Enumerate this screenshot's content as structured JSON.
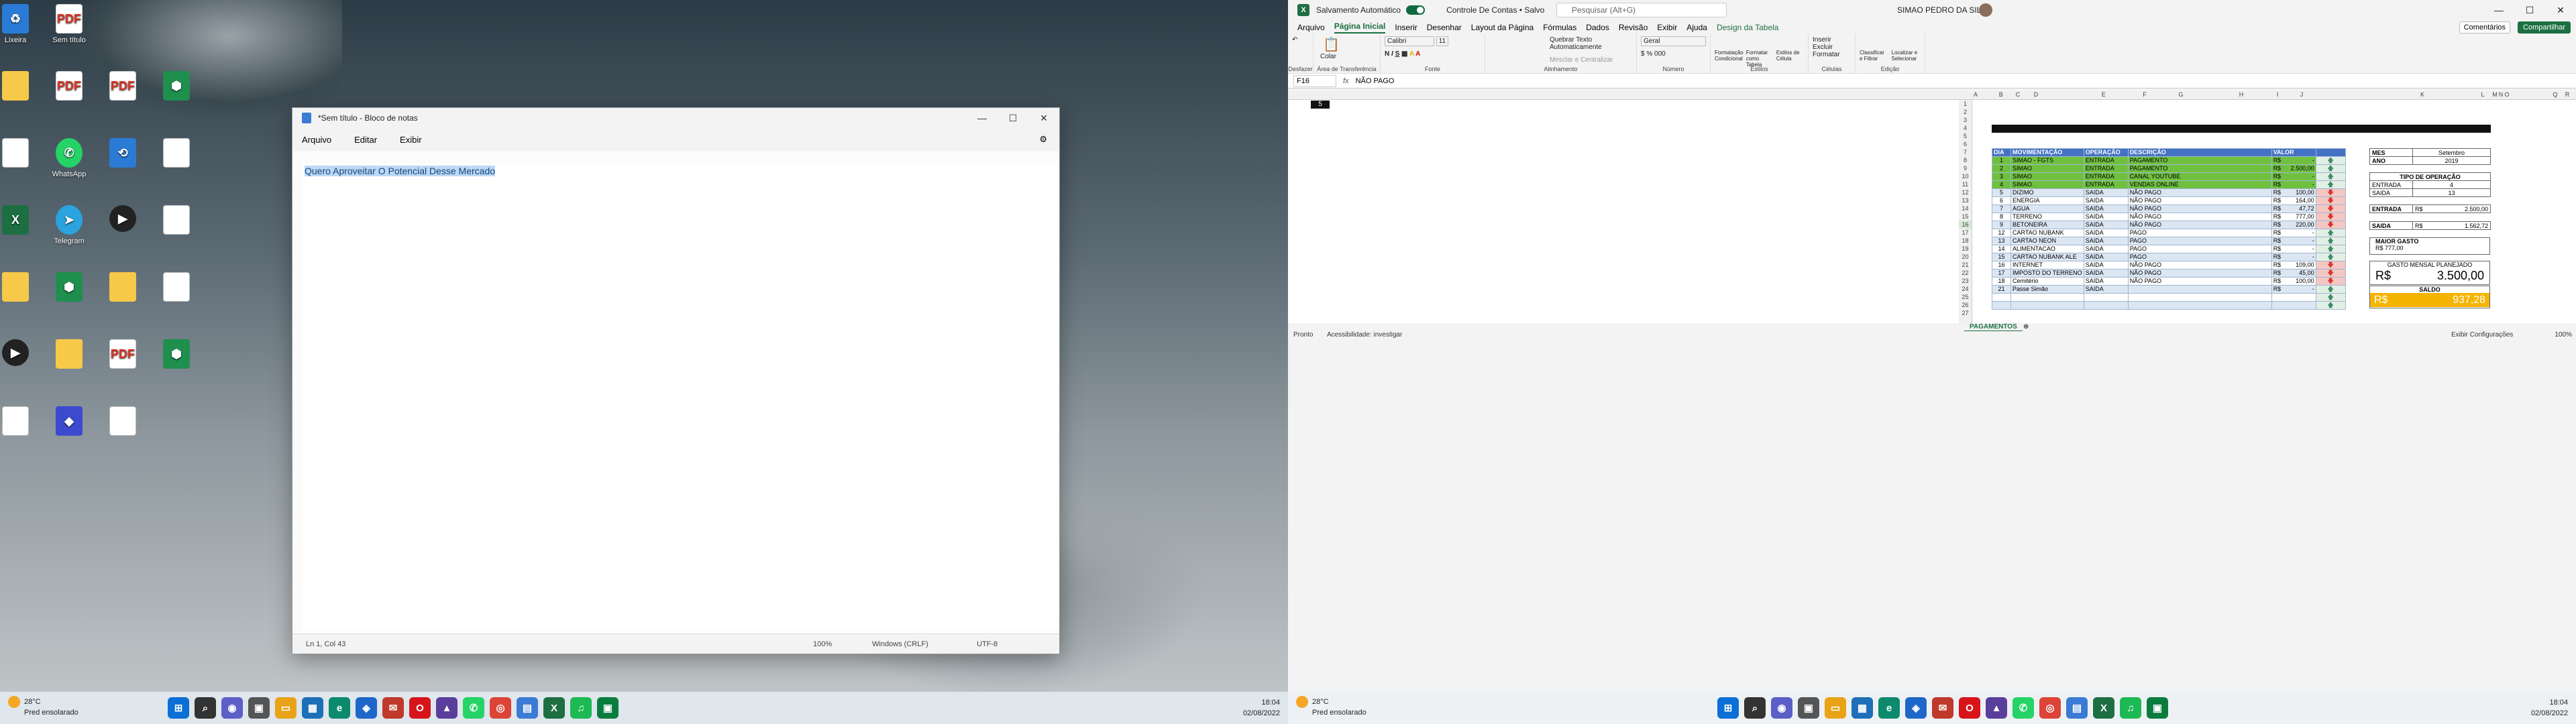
{
  "desktop": {
    "icons": [
      {
        "label": "Lixeira",
        "type": "blue",
        "glyph": "♻"
      },
      {
        "label": "Sem título",
        "type": "pdf",
        "glyph": "PDF"
      },
      {
        "label": "",
        "type": "folder",
        "glyph": ""
      },
      {
        "label": "",
        "type": "pdf",
        "glyph": "PDF"
      },
      {
        "label": "",
        "type": "pdf",
        "glyph": "PDF"
      },
      {
        "label": "",
        "type": "green",
        "glyph": "⬢"
      },
      {
        "label": "",
        "type": "doc",
        "glyph": ""
      },
      {
        "label": "WhatsApp",
        "type": "wa",
        "glyph": "✆"
      },
      {
        "label": "",
        "type": "blue",
        "glyph": "⟲"
      },
      {
        "label": "",
        "type": "doc",
        "glyph": ""
      },
      {
        "label": "",
        "type": "xls",
        "glyph": "X"
      },
      {
        "label": "Telegram",
        "type": "tg",
        "glyph": "➤"
      },
      {
        "label": "",
        "type": "vid",
        "glyph": "▶"
      },
      {
        "label": "",
        "type": "doc",
        "glyph": ""
      },
      {
        "label": "",
        "type": "folder",
        "glyph": ""
      },
      {
        "label": "",
        "type": "green",
        "glyph": "⬢"
      },
      {
        "label": "",
        "type": "folder",
        "glyph": ""
      },
      {
        "label": "",
        "type": "doc",
        "glyph": ""
      },
      {
        "label": "",
        "type": "vid",
        "glyph": "▶"
      },
      {
        "label": "",
        "type": "folder",
        "glyph": ""
      },
      {
        "label": "",
        "type": "pdf",
        "glyph": "PDF"
      },
      {
        "label": "",
        "type": "green",
        "glyph": "⬢"
      },
      {
        "label": "",
        "type": "doc",
        "glyph": ""
      },
      {
        "label": "",
        "type": "app",
        "glyph": "◆"
      },
      {
        "label": "",
        "type": "doc",
        "glyph": ""
      }
    ]
  },
  "notepad": {
    "title": "*Sem título - Bloco de notas",
    "menu": [
      "Arquivo",
      "Editar",
      "Exibir"
    ],
    "content": "Quero Aproveitar O Potencial Desse Mercado",
    "status": {
      "pos": "Ln 1, Col 43",
      "zoom": "100%",
      "eol": "Windows (CRLF)",
      "enc": "UTF-8"
    }
  },
  "taskbar_left": {
    "temp": "28°C",
    "weather": "Pred ensolarado",
    "time": "18:04",
    "date": "02/08/2022",
    "apps": [
      {
        "icon": "windows-icon",
        "c": "#0b6fd6",
        "g": "⊞"
      },
      {
        "icon": "search-icon",
        "c": "#333",
        "g": "⌕"
      },
      {
        "icon": "chat-icon",
        "c": "#5b5fc7",
        "g": "◉"
      },
      {
        "icon": "task-view-icon",
        "c": "#555",
        "g": "▣"
      },
      {
        "icon": "explorer-icon",
        "c": "#e8a317",
        "g": "▭"
      },
      {
        "icon": "store-icon",
        "c": "#1d6fb8",
        "g": "▦"
      },
      {
        "icon": "edge-icon",
        "c": "#0c8a6e",
        "g": "e"
      },
      {
        "icon": "shield-icon",
        "c": "#1e67c9",
        "g": "◈"
      },
      {
        "icon": "mail-icon",
        "c": "#c0392b",
        "g": "✉"
      },
      {
        "icon": "opera-icon",
        "c": "#d7141a",
        "g": "O"
      },
      {
        "icon": "app-icon",
        "c": "#5a3e9c",
        "g": "▲"
      },
      {
        "icon": "whatsapp-icon",
        "c": "#25d366",
        "g": "✆"
      },
      {
        "icon": "chrome-icon",
        "c": "#db4437",
        "g": "◎"
      },
      {
        "icon": "notepad-icon",
        "c": "#3a7bd5",
        "g": "▤"
      },
      {
        "icon": "excel-icon",
        "c": "#1d6f42",
        "g": "X"
      },
      {
        "icon": "spotify-icon",
        "c": "#1db954",
        "g": "♫"
      },
      {
        "icon": "app-icon",
        "c": "#0a7c3e",
        "g": "▣"
      }
    ]
  },
  "excel": {
    "autosave": "Salvamento Automático",
    "filename": "Controle De Contas • Salvo",
    "search": "Pesquisar (Alt+G)",
    "user": "SIMAO PEDRO DA SILVA",
    "menu": [
      "Arquivo",
      "Página Inicial",
      "Inserir",
      "Desenhar",
      "Layout da Página",
      "Fórmulas",
      "Dados",
      "Revisão",
      "Exibir",
      "Ajuda",
      "Design da Tabela"
    ],
    "comments": "Comentários",
    "share": "Compartilhar",
    "ribbon": {
      "clipboard": "Área de Transferência",
      "paste": "Colar",
      "undo": "Desfazer",
      "font_group": "Fonte",
      "font": "Calibri",
      "size": "11",
      "align_group": "Alinhamento",
      "wrap": "Quebrar Texto Automaticamente",
      "merge": "Mesclar e Centralizar",
      "number_group": "Número",
      "number_format": "Geral",
      "styles_group": "Estilos",
      "cond": "Formatação Condicional",
      "fmt_table": "Formatar como Tabela",
      "cell_styles": "Estilos de Célula",
      "cells_group": "Células",
      "insert": "Inserir",
      "delete": "Excluir",
      "format": "Formatar",
      "edit_group": "Edição",
      "sort": "Classificar e Filtrar",
      "find": "Localizar e Selecionar"
    },
    "namebox": "F16",
    "formula": "NÃO PAGO",
    "columns": [
      "A",
      "B",
      "C",
      "D",
      "E",
      "F",
      "G",
      "H",
      "I",
      "J",
      "K",
      "L",
      "M",
      "N",
      "O",
      "Q",
      "R"
    ],
    "a1": "5",
    "headers": [
      "DIA",
      "MOVIMENTAÇÃO",
      "OPERAÇÃO",
      "DESCRIÇÃO",
      "VALOR",
      ""
    ],
    "rows": [
      {
        "d": "1",
        "m": "SIMAO - FGTS",
        "o": "ENTRADA",
        "desc": "PAGAMENTO",
        "v": "-",
        "a": "up",
        "s": "g"
      },
      {
        "d": "2",
        "m": "SIMAO",
        "o": "ENTRADA",
        "desc": "PAGAMENTO",
        "v": "2.500,00",
        "a": "up",
        "s": "g"
      },
      {
        "d": "3",
        "m": "SIMAO",
        "o": "ENTRADA",
        "desc": "CANAL YOUTUBE",
        "v": "-",
        "a": "up",
        "s": "g"
      },
      {
        "d": "4",
        "m": "SIMAO",
        "o": "ENTRADA",
        "desc": "VENDAS ONLINE",
        "v": "-",
        "a": "up",
        "s": "g"
      },
      {
        "d": "5",
        "m": "DIZIMO",
        "o": "SAIDA",
        "desc": "NÃO PAGO",
        "v": "100,00",
        "a": "dn",
        "s": "n"
      },
      {
        "d": "6",
        "m": "ENERGIA",
        "o": "SAIDA",
        "desc": "NÃO PAGO",
        "v": "164,00",
        "a": "dn",
        "s": "w"
      },
      {
        "d": "7",
        "m": "AGUA",
        "o": "SAIDA",
        "desc": "NÃO PAGO",
        "v": "47,72",
        "a": "dn",
        "s": "n"
      },
      {
        "d": "8",
        "m": "TERRENO",
        "o": "SAIDA",
        "desc": "NÃO PAGO",
        "v": "777,00",
        "a": "dn",
        "s": "w"
      },
      {
        "d": "9",
        "m": "BETONEIRA",
        "o": "SAIDA",
        "desc": "NÃO PAGO",
        "v": "220,00",
        "a": "dn",
        "s": "n"
      },
      {
        "d": "12",
        "m": "CARTAO NUBANK",
        "o": "SAIDA",
        "desc": "PAGO",
        "v": "-",
        "a": "up",
        "s": "w"
      },
      {
        "d": "13",
        "m": "CARTAO NEON",
        "o": "SAIDA",
        "desc": "PAGO",
        "v": "-",
        "a": "up",
        "s": "n"
      },
      {
        "d": "14",
        "m": "ALIMENTACAO",
        "o": "SAIDA",
        "desc": "PAGO",
        "v": "-",
        "a": "up",
        "s": "w"
      },
      {
        "d": "15",
        "m": "CARTAO NUBANK ALE",
        "o": "SAIDA",
        "desc": "PAGO",
        "v": "-",
        "a": "up",
        "s": "n"
      },
      {
        "d": "16",
        "m": "INTERNET",
        "o": "SAIDA",
        "desc": "NÃO PAGO",
        "v": "109,00",
        "a": "dn",
        "s": "w"
      },
      {
        "d": "17",
        "m": "IMPOSTO DO TERRENO",
        "o": "SAIDA",
        "desc": "NÃO PAGO",
        "v": "45,00",
        "a": "dn",
        "s": "n"
      },
      {
        "d": "18",
        "m": "Cemitério",
        "o": "SAIDA",
        "desc": "NÃO PAGO",
        "v": "100,00",
        "a": "dn",
        "s": "w"
      },
      {
        "d": "21",
        "m": "Passe Simão",
        "o": "SAIDA",
        "desc": "",
        "v": "-",
        "a": "up",
        "s": "n"
      },
      {
        "d": "",
        "m": "",
        "o": "",
        "desc": "",
        "v": "",
        "a": "up",
        "s": "w"
      },
      {
        "d": "",
        "m": "",
        "o": "",
        "desc": "",
        "v": "",
        "a": "up",
        "s": "n"
      }
    ],
    "currency": "R$",
    "summary": {
      "mes_label": "MES",
      "mes": "Setembro",
      "ano_label": "ANO",
      "ano": "2019",
      "tipo_label": "TIPO DE OPERAÇÃO",
      "entrada_label": "ENTRADA",
      "entrada_count": "4",
      "saida_label": "SAIDA",
      "saida_count": "13",
      "entrada_total": "2.500,00",
      "saida_total": "1.562,72",
      "maior_label": "MAIOR GASTO",
      "maior": "777,00",
      "planejado_label": "GASTO MENSAL PLANEJADO",
      "planejado": "3.500,00",
      "saldo_label": "SALDO",
      "saldo": "937,28"
    },
    "sheet": "PAGAMENTOS",
    "status_ready": "Pronto",
    "accessibility": "Acessibilidade: investigar",
    "display_settings": "Exibir Configurações",
    "zoom": "100%"
  },
  "taskbar_right": {
    "temp": "28°C",
    "weather": "Pred ensolarado",
    "time": "18:04",
    "date": "02/08/2022"
  }
}
